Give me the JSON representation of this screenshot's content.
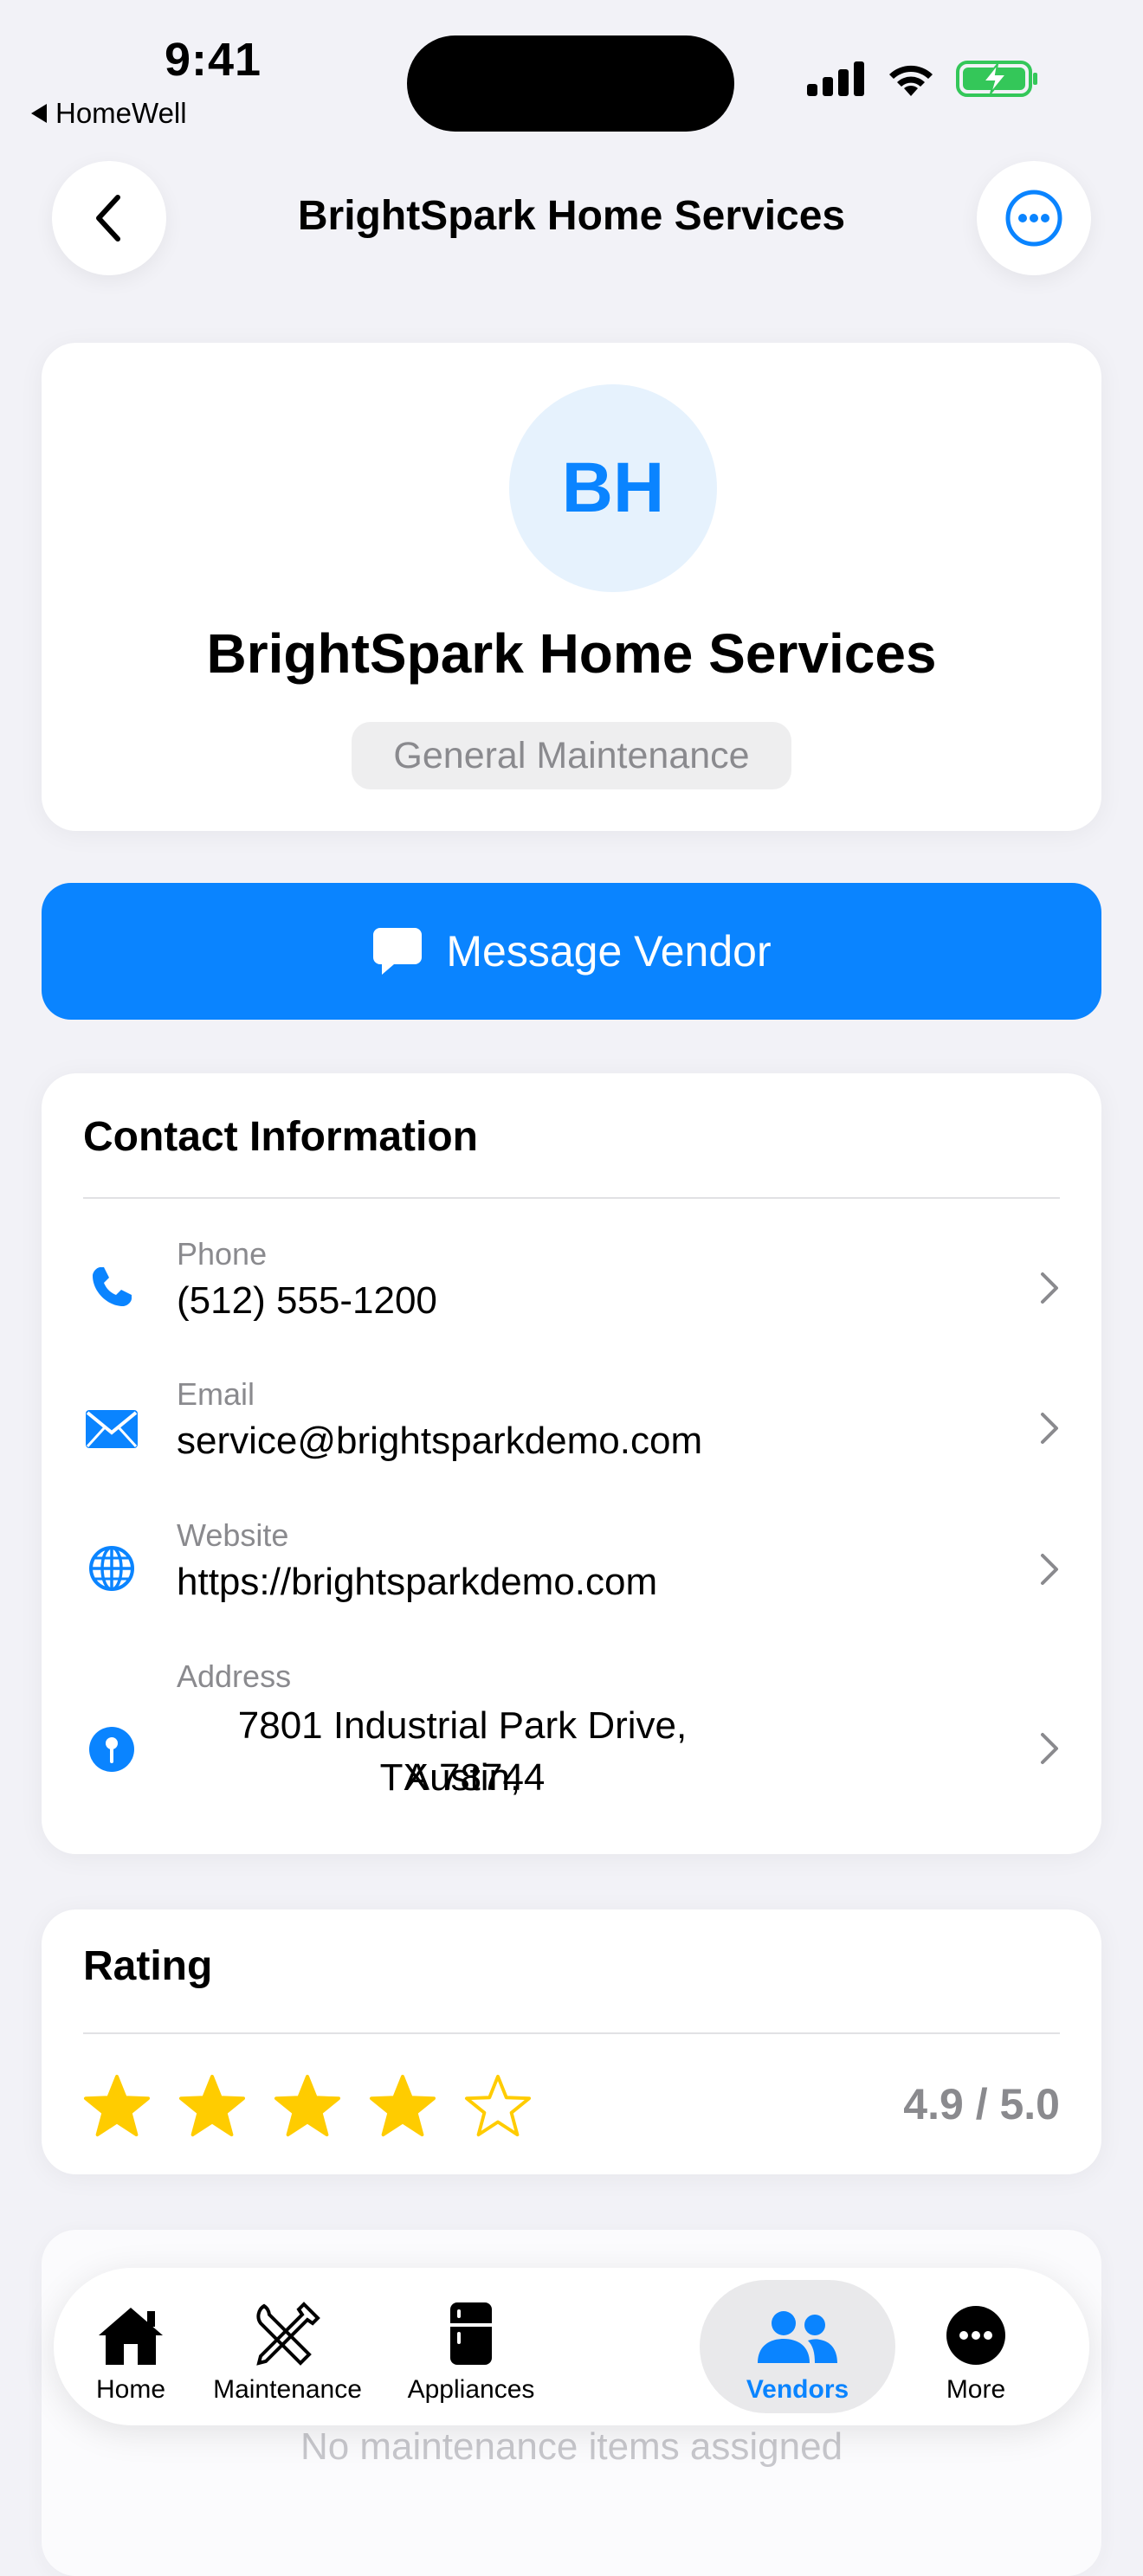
{
  "status_bar": {
    "time": "9:41",
    "back_app": "HomeWell"
  },
  "nav": {
    "title": "BrightSpark Home Services"
  },
  "vendor": {
    "initials": "BH",
    "name": "BrightSpark Home Services",
    "category": "General Maintenance"
  },
  "actions": {
    "message_label": "Message Vendor"
  },
  "contact": {
    "title": "Contact Information",
    "phone_label": "Phone",
    "phone": "(512) 555-1200",
    "email_label": "Email",
    "email": "service@brightsparkdemo.com",
    "website_label": "Website",
    "website": "https://brightsparkdemo.com",
    "address_label": "Address",
    "address_line1": "7801 Industrial Park Drive, Austin,",
    "address_line2": "TX 78744"
  },
  "rating": {
    "title": "Rating",
    "value_text": "4.9 / 5.0",
    "filled_stars": 4,
    "total_stars": 5
  },
  "maintenance": {
    "empty_text": "No maintenance items assigned"
  },
  "tabbar": {
    "home": "Home",
    "maintenance": "Maintenance",
    "appliances": "Appliances",
    "vendors": "Vendors",
    "more": "More",
    "active": "Vendors"
  },
  "colors": {
    "accent": "#0a84ff",
    "star": "#ffcc00",
    "secondary_text": "#8a8a8e",
    "battery": "#34c759"
  }
}
